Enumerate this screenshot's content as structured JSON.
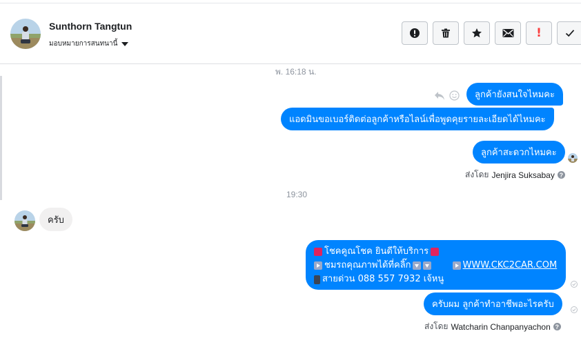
{
  "header": {
    "contact_name": "Sunthorn Tangtun",
    "assign_label": "มอบหมายการสนทนานี้",
    "actions": [
      {
        "icon": "alert-circle-icon",
        "name": "mark-spam-button"
      },
      {
        "icon": "trash-icon",
        "name": "delete-button"
      },
      {
        "icon": "star-icon",
        "name": "star-button"
      },
      {
        "icon": "envelope-icon",
        "name": "mark-unread-button"
      },
      {
        "icon": "exclamation-icon",
        "name": "follow-up-button"
      },
      {
        "icon": "checkmark-icon",
        "name": "mark-done-button"
      }
    ]
  },
  "conversation": {
    "time_1": "พ. 16:18 น.",
    "msg_1": "ลูกค้ายังสนใจไหมคะ",
    "msg_2": "แอดมินขอเบอร์ติดต่อลูกค้าหรือไลน์เพื่อพูดคุยรายละเอียดได้ไหมคะ",
    "msg_3": "ลูกค้าสะดวกไหมคะ",
    "sent_by_label": "ส่งโดย",
    "agent_1": "Jenjira Suksabay",
    "time_2": "19:30",
    "msg_in_1": "ครับ",
    "msg_4": {
      "line_1": "โชคคูณโชค ยินดีให้บริการ",
      "line_2_text": "ชมรถคุณภาพได้ที่คลิ๊ก",
      "line_2_link": "WWW.CKC2CAR.COM",
      "line_3": "สายด่วน 088 557 7932 เจ้หนู"
    },
    "msg_5": "ครับผม ลูกค้าทำอาชีพอะไรครับ",
    "agent_2": "Watcharin Chanpanyachon"
  },
  "colors": {
    "outgoing_bubble": "#0084ff",
    "incoming_bubble": "#f1f0f0",
    "alert_red": "#fa3e3e"
  }
}
